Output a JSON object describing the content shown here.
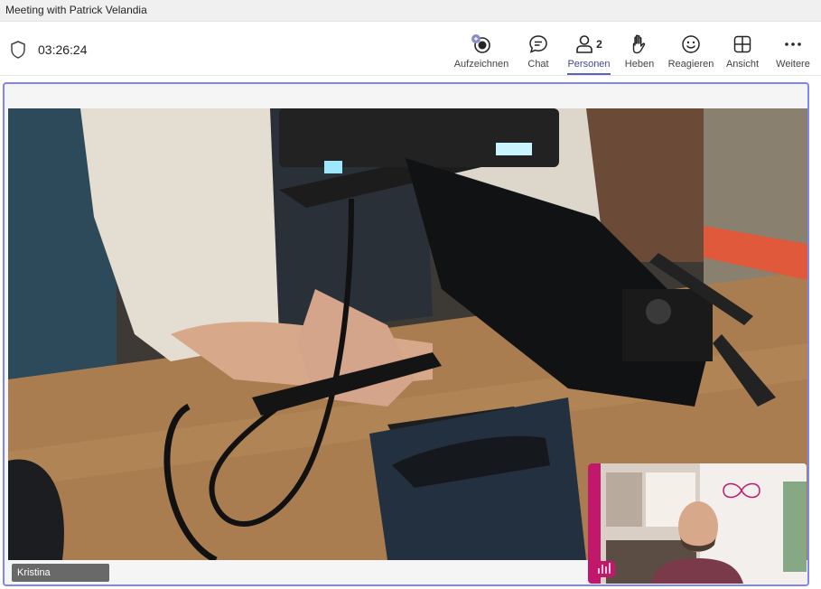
{
  "window": {
    "title": "Meeting with Patrick Velandia"
  },
  "toolbar": {
    "timer": "03:26:24",
    "buttons": [
      {
        "label": "Aufzeichnen",
        "icon": "record-icon"
      },
      {
        "label": "Chat",
        "icon": "chat-icon"
      },
      {
        "label": "Personen",
        "icon": "people-icon",
        "badge": "2"
      },
      {
        "label": "Heben",
        "icon": "raise-hand-icon"
      },
      {
        "label": "Reagieren",
        "icon": "smiley-icon"
      },
      {
        "label": "Ansicht",
        "icon": "view-grid-icon"
      },
      {
        "label": "Weitere",
        "icon": "more-icon"
      }
    ]
  },
  "stage": {
    "participant_name": "Kristina"
  },
  "colors": {
    "accent": "#5b5fc7",
    "stage_border": "#7f85f5",
    "titlebar_bg": "#f0f0f0"
  }
}
